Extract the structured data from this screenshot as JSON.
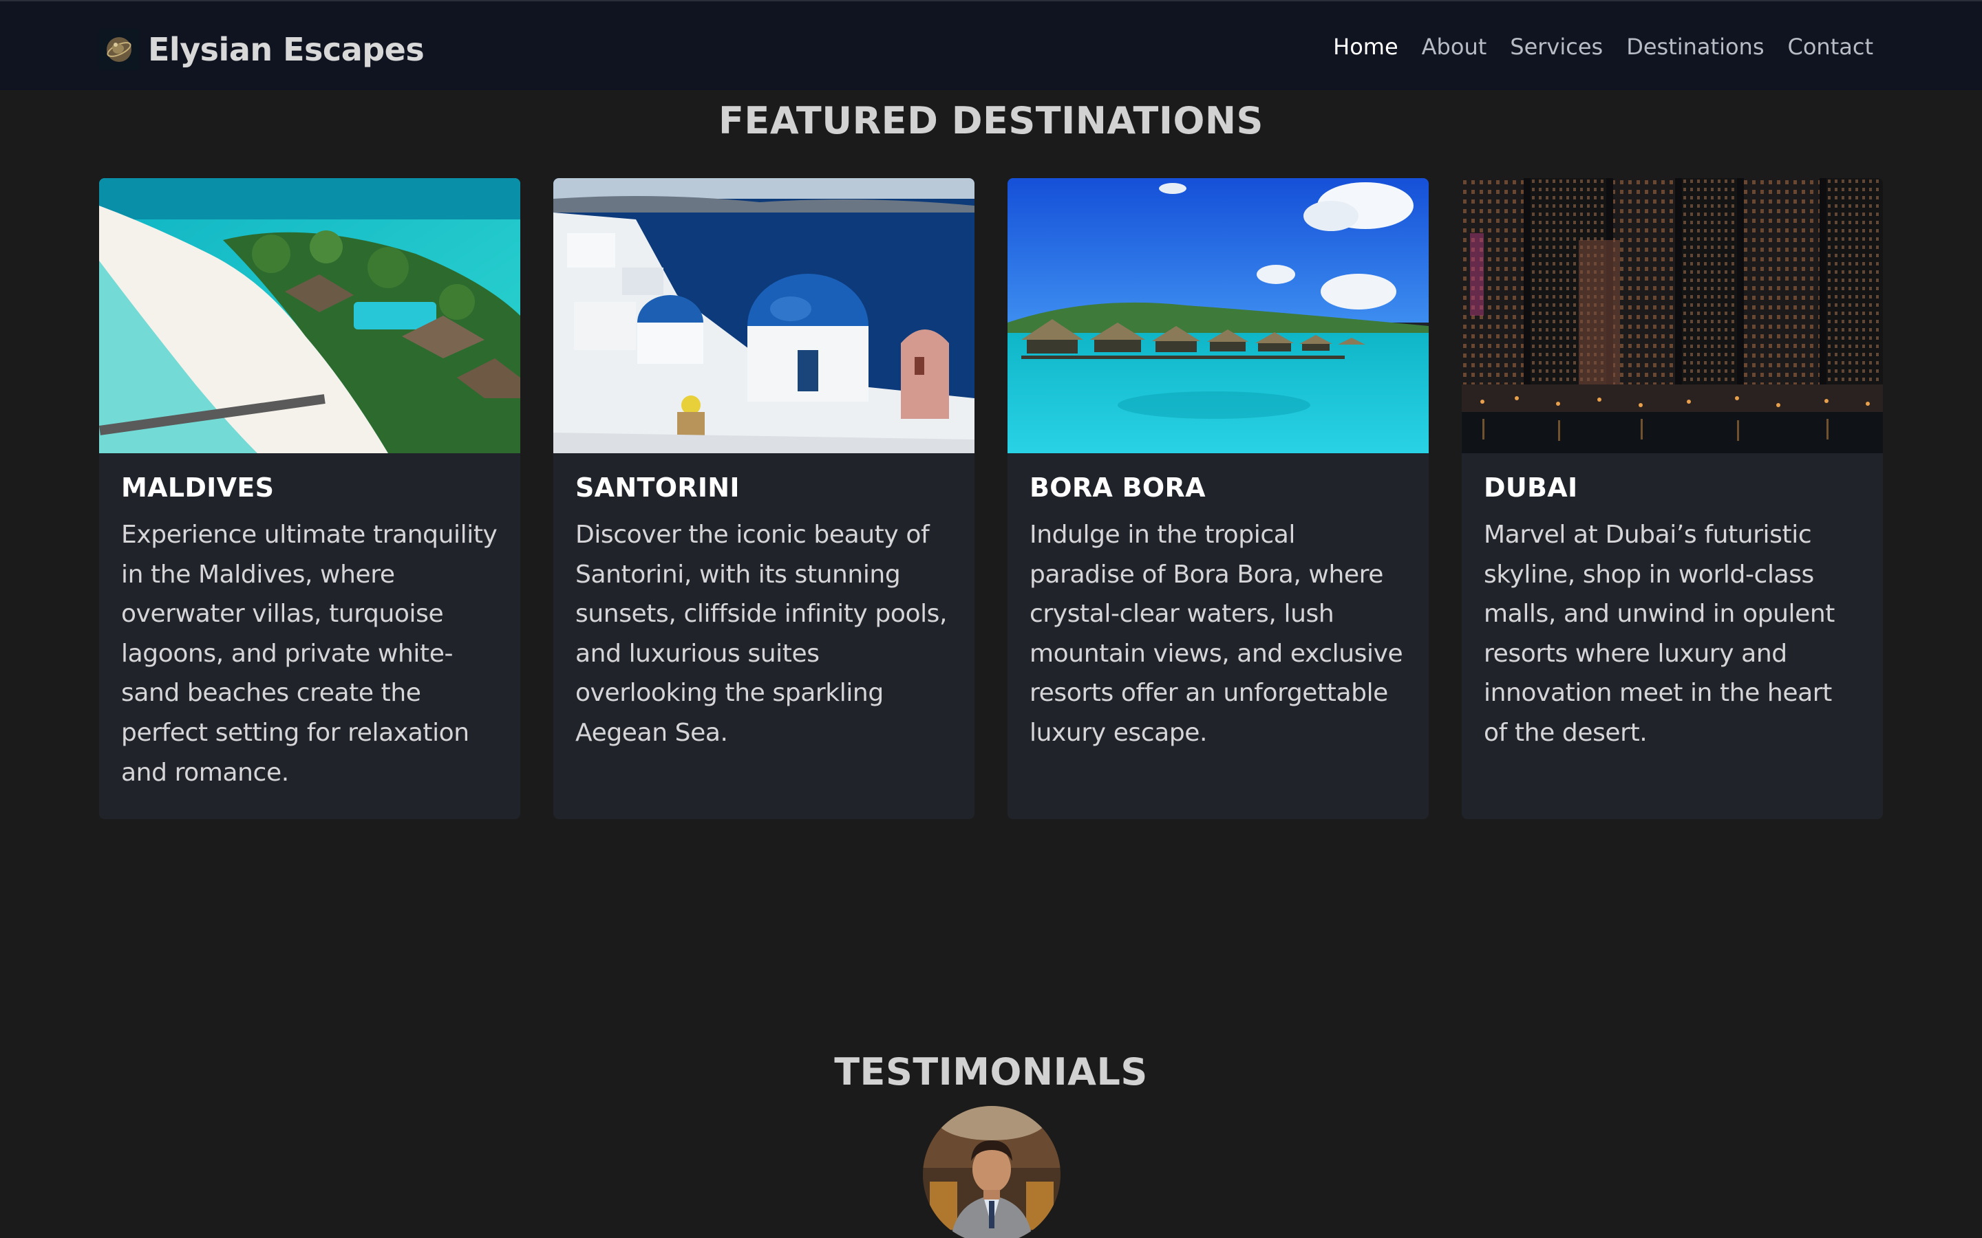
{
  "brand": {
    "name": "Elysian Escapes",
    "logo_icon": "globe-logo-icon"
  },
  "nav": {
    "items": [
      {
        "label": "Home",
        "active": true
      },
      {
        "label": "About",
        "active": false
      },
      {
        "label": "Services",
        "active": false
      },
      {
        "label": "Destinations",
        "active": false
      },
      {
        "label": "Contact",
        "active": false
      }
    ]
  },
  "featured": {
    "title": "FEATURED DESTINATIONS",
    "cards": [
      {
        "title": "MALDIVES",
        "text": "Experience ultimate tranquility in the Maldives, where overwater villas, turquoise lagoons, and private white-sand beaches create the perfect setting for relaxation and romance."
      },
      {
        "title": "SANTORINI",
        "text": "Discover the iconic beauty of Santorini, with its stunning sunsets, cliffside infinity pools, and luxurious suites overlooking the sparkling Aegean Sea."
      },
      {
        "title": "BORA BORA",
        "text": "Indulge in the tropical paradise of Bora Bora, where crystal-clear waters, lush mountain views, and exclusive resorts offer an unforgettable luxury escape."
      },
      {
        "title": "DUBAI",
        "text": "Marvel at Dubai’s futuristic skyline, shop in world-class malls, and unwind in opulent resorts where luxury and innovation meet in the heart of the desert."
      }
    ]
  },
  "testimonials": {
    "title": "TESTIMONIALS"
  },
  "colors": {
    "background": "#1b1b1c",
    "navbar": "#101420",
    "card": "#21232b",
    "text": "#d6d6d8"
  }
}
